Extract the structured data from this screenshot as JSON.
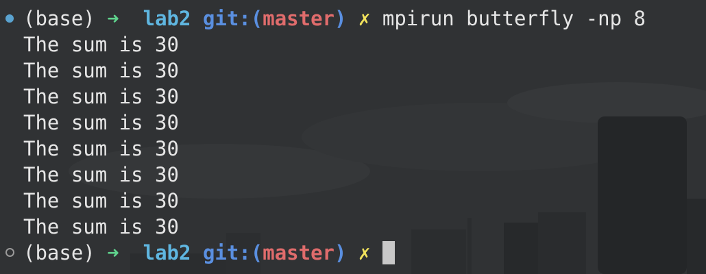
{
  "prompt": {
    "env": "(base)",
    "arrow": "➜",
    "dir": "lab2",
    "git_label": "git:(",
    "branch": "master",
    "git_close": ")",
    "dirty_mark": "✗"
  },
  "command": "mpirun butterfly -np 8",
  "output": [
    "The sum is 30",
    "The sum is 30",
    "The sum is 30",
    "The sum is 30",
    "The sum is 30",
    "The sum is 30",
    "The sum is 30",
    "The sum is 30"
  ],
  "colors": {
    "background": "#2f3133",
    "arrow": "#5fd38d",
    "dir": "#5fb6e0",
    "git": "#5a8fe0",
    "branch": "#e06c6c",
    "dirty": "#f2e35c"
  }
}
